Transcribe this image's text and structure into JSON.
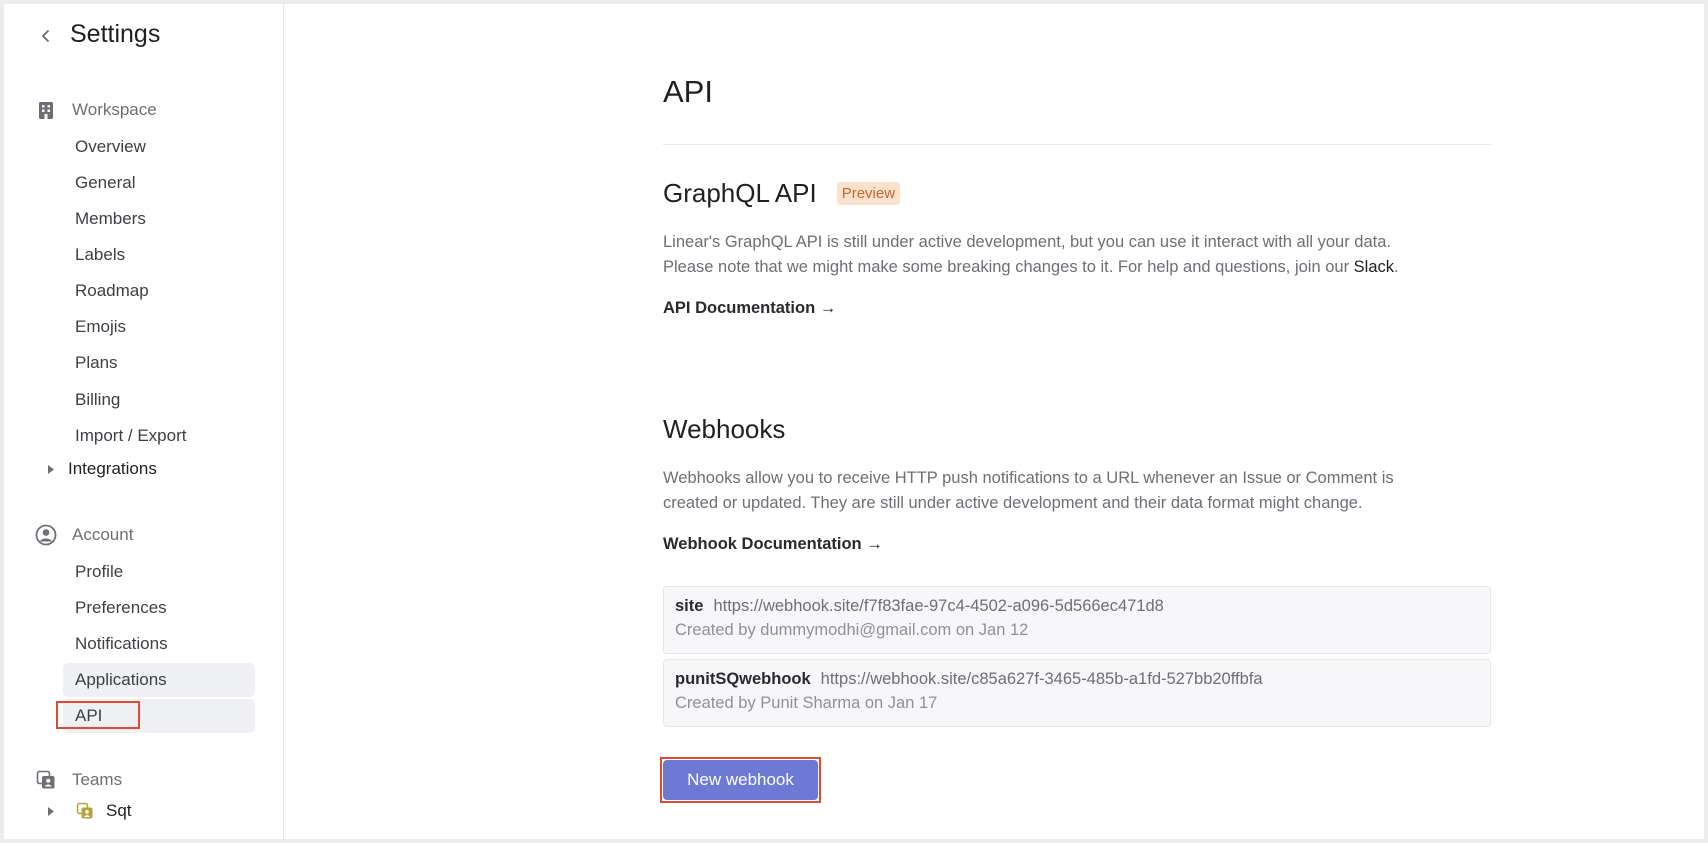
{
  "sidebar": {
    "title": "Settings",
    "workspace": {
      "label": "Workspace",
      "items": [
        "Overview",
        "General",
        "Members",
        "Labels",
        "Roadmap",
        "Emojis",
        "Plans",
        "Billing",
        "Import / Export"
      ],
      "integrations": "Integrations"
    },
    "account": {
      "label": "Account",
      "items": [
        "Profile",
        "Preferences",
        "Notifications",
        "Applications",
        "API"
      ]
    },
    "teams": {
      "label": "Teams",
      "team": "Sqt"
    }
  },
  "main": {
    "title": "API",
    "graphql": {
      "heading": "GraphQL API",
      "badge": "Preview",
      "desc_1": "Linear's GraphQL API is still under active development, but you can use it interact with all your data.",
      "desc_2": "Please note that we might make some breaking changes to it. For help and questions, join our ",
      "desc_link": "Slack",
      "desc_end": ".",
      "doc_link": "API Documentation →"
    },
    "webhooks": {
      "heading": "Webhooks",
      "desc_1": "Webhooks allow you to receive HTTP push notifications to a URL whenever an Issue or Comment is",
      "desc_2": "created or updated. They are still under active development and their data format might change.",
      "doc_link": "Webhook Documentation →",
      "list": [
        {
          "name": "site",
          "url": "https://webhook.site/f7f83fae-97c4-4502-a096-5d566ec471d8",
          "created": "Created by dummymodhi@gmail.com on Jan 12"
        },
        {
          "name": "punitSQwebhook",
          "url": "https://webhook.site/c85a627f-3465-485b-a1fd-527bb20ffbfa",
          "created": "Created by Punit Sharma on Jan 17"
        }
      ],
      "new_button": "New webhook"
    }
  },
  "colors": {
    "accent": "#6e79d6",
    "highlight_box": "#e04a2f",
    "badge_bg": "#fbe2cd",
    "badge_text": "#c36a33"
  }
}
